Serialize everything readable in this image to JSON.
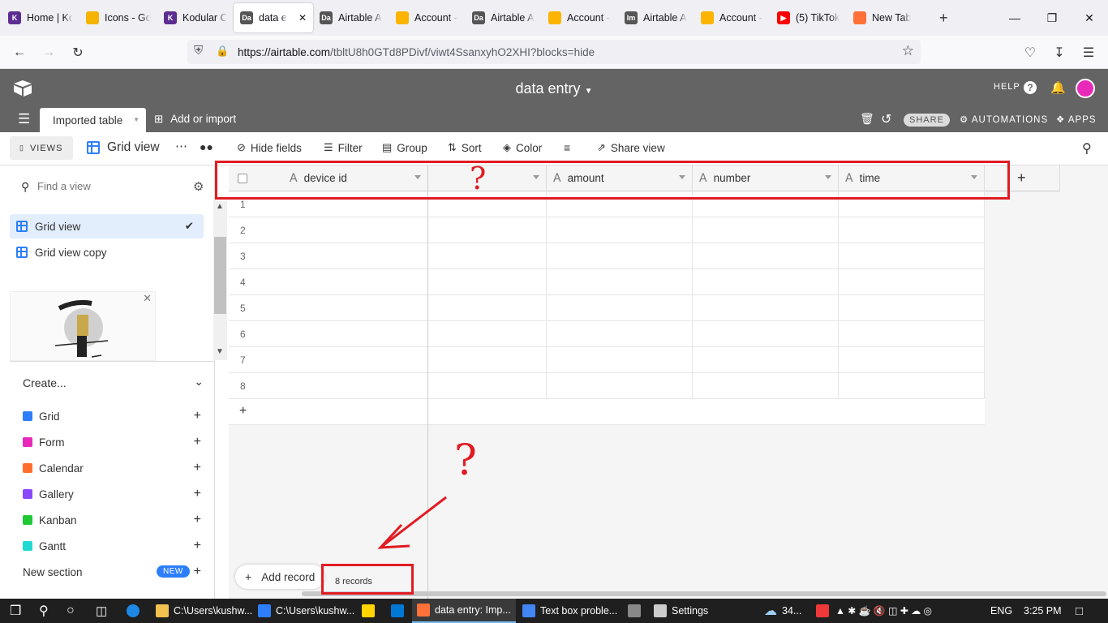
{
  "browser": {
    "tabs": [
      {
        "label": "Home | Ko",
        "icon": "kodular-icon",
        "color": "#5c2d91",
        "glyph": "K"
      },
      {
        "label": "Icons - Go",
        "icon": "icons-icon",
        "color": "#f4b400",
        "glyph": ""
      },
      {
        "label": "Kodular C",
        "icon": "kodular-icon",
        "color": "#5c2d91",
        "glyph": "K"
      },
      {
        "label": "data e",
        "icon": "data-icon",
        "color": "#555555",
        "glyph": "Da",
        "active": true
      },
      {
        "label": "Airtable A",
        "icon": "data-icon",
        "color": "#555555",
        "glyph": "Da"
      },
      {
        "label": "Account -",
        "icon": "airtable-icon",
        "color": "#fcb400",
        "glyph": ""
      },
      {
        "label": "Airtable A",
        "icon": "data-icon",
        "color": "#555555",
        "glyph": "Da"
      },
      {
        "label": "Account -",
        "icon": "airtable-icon",
        "color": "#fcb400",
        "glyph": ""
      },
      {
        "label": "Airtable A",
        "icon": "im-icon",
        "color": "#555555",
        "glyph": "Im"
      },
      {
        "label": "Account -",
        "icon": "airtable-icon",
        "color": "#fcb400",
        "glyph": ""
      },
      {
        "label": "(5) TikTok",
        "icon": "youtube-icon",
        "color": "#ff0000",
        "glyph": "▶"
      },
      {
        "label": "New Tab",
        "icon": "firefox-icon",
        "color": "#ff7139",
        "glyph": ""
      }
    ],
    "url_host": "https://airtable.com",
    "url_path": "/tbltU8h0GTd8PDivf/viwt4SsanxyhO2XHI?blocks=hide"
  },
  "app": {
    "base_title": "data entry",
    "help": "HELP",
    "share": "SHARE",
    "automations": "AUTOMATIONS",
    "apps": "APPS",
    "table_tab": "Imported table",
    "add_import": "Add or import"
  },
  "viewbar": {
    "views": "VIEWS",
    "view_name": "Grid view",
    "hide_fields": "Hide fields",
    "filter": "Filter",
    "group": "Group",
    "sort": "Sort",
    "color": "Color",
    "share_view": "Share view"
  },
  "sidebar": {
    "find_placeholder": "Find a view",
    "views": [
      "Grid view",
      "Grid view copy"
    ],
    "create": "Create...",
    "create_items": [
      {
        "label": "Grid",
        "color": "#2d7ff9"
      },
      {
        "label": "Form",
        "color": "#e929ba"
      },
      {
        "label": "Calendar",
        "color": "#ff6f2c"
      },
      {
        "label": "Gallery",
        "color": "#8b46ff"
      },
      {
        "label": "Kanban",
        "color": "#20c933"
      },
      {
        "label": "Gantt",
        "color": "#20d9d2"
      }
    ],
    "new_section": "New section",
    "new_badge": "NEW"
  },
  "grid": {
    "columns": [
      "device id",
      "",
      "amount",
      "number",
      "time"
    ],
    "rows": [
      "1",
      "2",
      "3",
      "4",
      "5",
      "6",
      "7",
      "8"
    ],
    "add_record": "Add record",
    "records": "8 records"
  },
  "taskbar": {
    "items": [
      {
        "label": "C:\\Users\\kushw...",
        "color": "#f2c14e"
      },
      {
        "label": "C:\\Users\\kushw...",
        "color": "#2d7ff9"
      },
      {
        "label": "",
        "color": "#ffd400"
      },
      {
        "label": "",
        "color": "#0078d4"
      },
      {
        "label": "data entry: Imp...",
        "color": "#ff7139",
        "active": true
      },
      {
        "label": "Text box proble...",
        "color": "#4285f4"
      },
      {
        "label": "",
        "color": "#888888"
      },
      {
        "label": "Settings",
        "color": "#cccccc"
      }
    ],
    "weather": "34...",
    "lang": "ENG",
    "clock": "3:25 PM"
  },
  "annotation": {
    "question": "?"
  }
}
